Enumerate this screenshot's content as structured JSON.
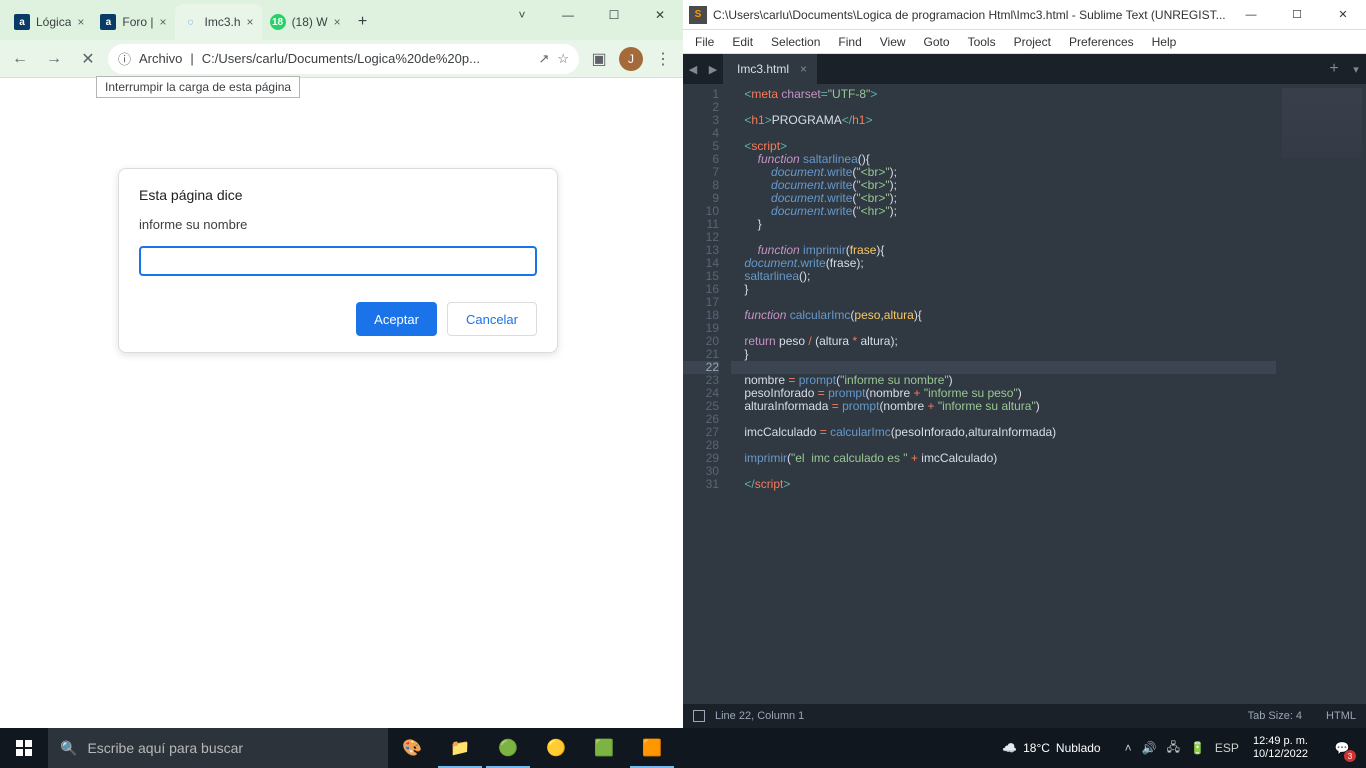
{
  "chrome": {
    "tabs": [
      {
        "favicon": "a",
        "title": "Lógica"
      },
      {
        "favicon": "a",
        "title": "Foro |"
      },
      {
        "favicon": "spinner",
        "title": "Imc3.h",
        "active": true
      },
      {
        "favicon": "wa",
        "title": "(18) W"
      }
    ],
    "win": {
      "min": "—",
      "max": "☐",
      "close": "✕",
      "down": "˅"
    },
    "nav": {
      "back": "←",
      "fwd": "→",
      "stop": "✕",
      "menu": "⋮"
    },
    "addr": {
      "info": "ⓘ",
      "chip": "Archivo",
      "sep": "|",
      "url": "C:/Users/carlu/Documents/Logica%20de%20p...",
      "share": "↗",
      "star": "☆",
      "panel": "▣"
    },
    "profile": "J",
    "tooltip": "Interrumpir la carga de esta página",
    "page_heading": "Esta página dice",
    "dialog": {
      "title": "Esta página dice",
      "message": "informe su nombre",
      "value": "",
      "accept": "Aceptar",
      "cancel": "Cancelar"
    }
  },
  "sublime": {
    "title": "C:\\Users\\carlu\\Documents\\Logica de programacion Html\\Imc3.html - Sublime Text (UNREGIST...",
    "menu": [
      "File",
      "Edit",
      "Selection",
      "Find",
      "View",
      "Goto",
      "Tools",
      "Project",
      "Preferences",
      "Help"
    ],
    "tab": "Imc3.html",
    "status": {
      "pos": "Line 22, Column 1",
      "tabsize": "Tab Size: 4",
      "syntax": "HTML"
    },
    "code_lines": 31,
    "highlight_line": 22
  },
  "taskbar": {
    "search_placeholder": "Escribe aquí para buscar",
    "weather": {
      "temp": "18°C",
      "cond": "Nublado"
    },
    "clock": {
      "time": "12:49 p. m.",
      "date": "10/12/2022"
    },
    "notif_count": "3"
  }
}
